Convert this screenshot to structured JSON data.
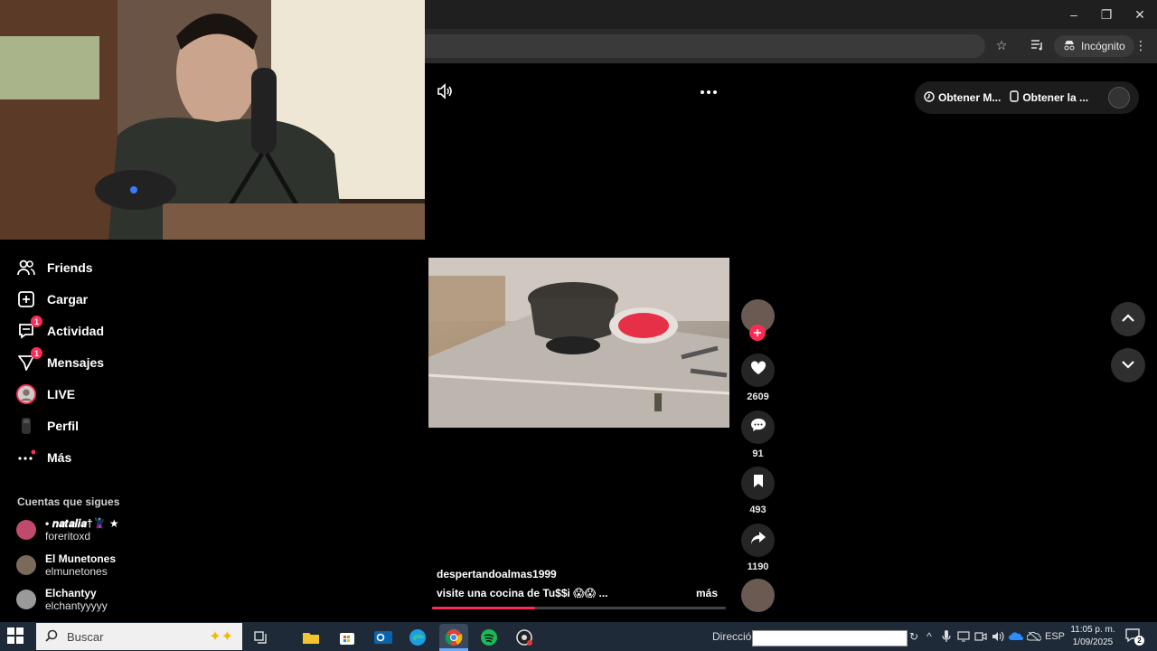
{
  "browser": {
    "incognito_label": "Incógnito",
    "minimize": "–",
    "restore": "❐",
    "close": "✕"
  },
  "header": {
    "get_app_1": "Obtener M...",
    "get_app_2": "Obtener la ..."
  },
  "sidebar": {
    "items": [
      {
        "label": "Friends",
        "icon": "friends-icon"
      },
      {
        "label": "Cargar",
        "icon": "upload-icon"
      },
      {
        "label": "Actividad",
        "icon": "activity-icon",
        "badge": "1"
      },
      {
        "label": "Mensajes",
        "icon": "messages-icon",
        "badge": "1"
      },
      {
        "label": "LIVE",
        "icon": "live-avatar-icon"
      },
      {
        "label": "Perfil",
        "icon": "profile-icon"
      },
      {
        "label": "Más",
        "icon": "more-icon"
      }
    ],
    "following_heading": "Cuentas que sigues",
    "following": [
      {
        "name": "• 𝒏𝒂𝒕𝒂𝒍𝒊𝒂†🦹 ★",
        "handle": "foreritoxd"
      },
      {
        "name": "El Munetones",
        "handle": "elmunetones"
      },
      {
        "name": "Elchantyy",
        "handle": "elchantyyyyy"
      }
    ]
  },
  "video": {
    "author": "despertandoalmas1999",
    "caption": "visite una cocina de Tu$$i 😱😱 ...",
    "more": "más",
    "progress": 0.35
  },
  "actions": {
    "likes": "2609",
    "comments": "91",
    "saves": "493",
    "shares": "1190"
  },
  "taskbar": {
    "search_placeholder": "Buscar",
    "address_label": "Dirección",
    "lang": "ESP",
    "time": "11:05 p. m.",
    "date": "1/09/2025",
    "notif_count": "2"
  }
}
